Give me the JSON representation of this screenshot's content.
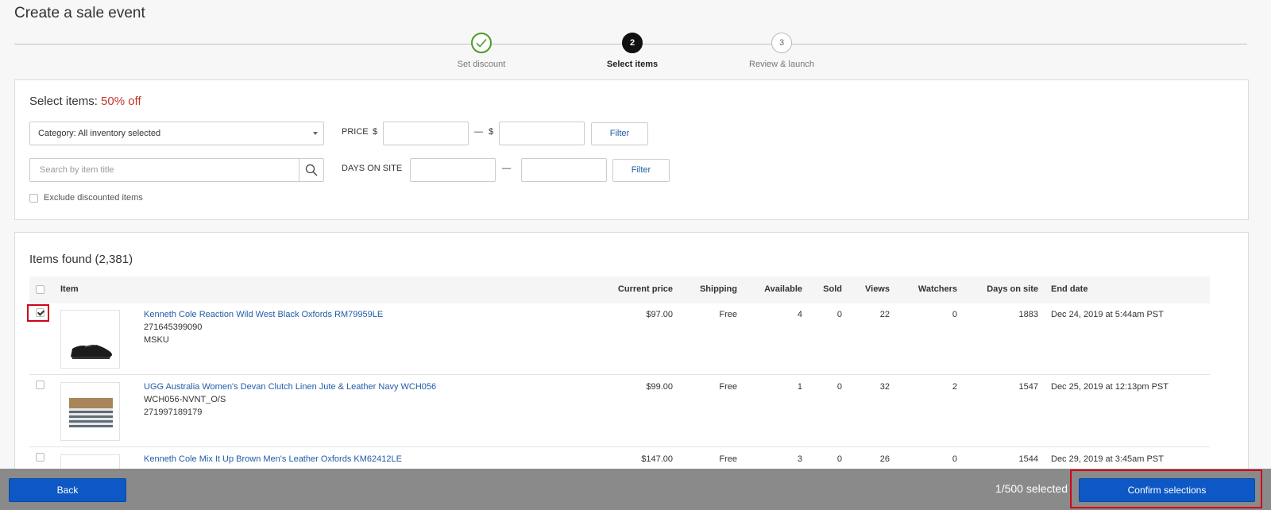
{
  "page": {
    "title": "Create a sale event"
  },
  "stepper": {
    "steps": [
      {
        "number": "",
        "label": "Set discount",
        "state": "done"
      },
      {
        "number": "2",
        "label": "Select items",
        "state": "active"
      },
      {
        "number": "3",
        "label": "Review & launch",
        "state": "upcoming"
      }
    ]
  },
  "filters": {
    "heading": "Select items:",
    "discount": "50% off",
    "category": "Category: All inventory selected",
    "search_placeholder": "Search by item title",
    "exclude_label": "Exclude discounted items",
    "exclude_checked": false,
    "price_label": "PRICE",
    "currency": "$",
    "dash": "—",
    "days_label": "DAYS ON SITE",
    "filter_button": "Filter"
  },
  "results": {
    "heading": "Items found (2,381)",
    "columns": {
      "item": "Item",
      "price": "Current price",
      "shipping": "Shipping",
      "available": "Available",
      "sold": "Sold",
      "views": "Views",
      "watchers": "Watchers",
      "days": "Days on site",
      "end": "End date"
    },
    "rows": [
      {
        "checked": true,
        "title": "Kenneth Cole Reaction Wild West Black Oxfords RM79959LE",
        "line2": "271645399090",
        "line3": "MSKU",
        "price": "$97.00",
        "shipping": "Free",
        "available": "4",
        "sold": "0",
        "views": "22",
        "watchers": "0",
        "days": "1883",
        "end": "Dec 24, 2019 at 5:44am PST",
        "thumb": "black-oxford-shoe"
      },
      {
        "checked": false,
        "title": "UGG Australia Women's Devan Clutch Linen Jute & Leather Navy WCH056",
        "line2": "WCH056-NVNT_O/S",
        "line3": "271997189179",
        "price": "$99.00",
        "shipping": "Free",
        "available": "1",
        "sold": "0",
        "views": "32",
        "watchers": "2",
        "days": "1547",
        "end": "Dec 25, 2019 at 12:13pm PST",
        "thumb": "striped-clutch"
      },
      {
        "checked": false,
        "title": "Kenneth Cole Mix It Up Brown Men's Leather Oxfords KM62412LE",
        "line2": "",
        "line3": "",
        "price": "$147.00",
        "shipping": "Free",
        "available": "3",
        "sold": "0",
        "views": "26",
        "watchers": "0",
        "days": "1544",
        "end": "Dec 29, 2019 at 3:45am PST",
        "thumb": "brown-oxford-shoe"
      }
    ]
  },
  "footer": {
    "back": "Back",
    "selected": "1/500 selected",
    "confirm": "Confirm selections"
  }
}
